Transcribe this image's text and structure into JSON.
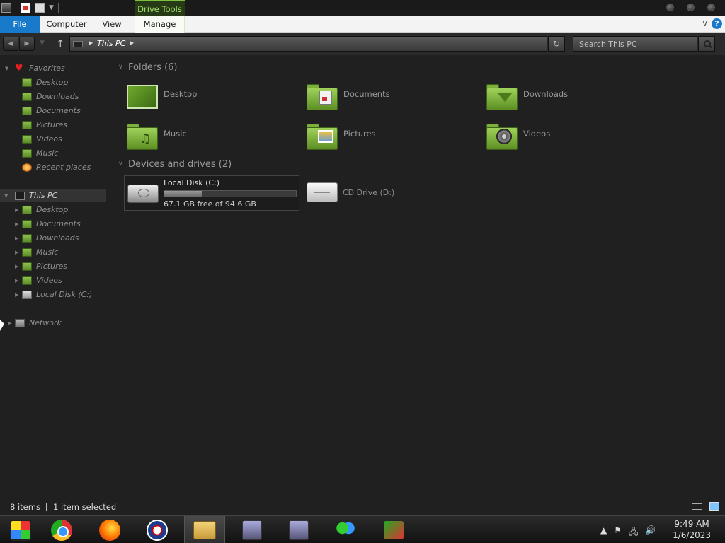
{
  "titlebar": {
    "context_tab": "Drive Tools"
  },
  "ribbon": {
    "tabs": [
      {
        "label": "File"
      },
      {
        "label": "Computer"
      },
      {
        "label": "View"
      },
      {
        "label": "Manage"
      }
    ],
    "help_label": "?",
    "accent": "#1979ca"
  },
  "address": {
    "path": "This PC",
    "search_placeholder": "Search This PC"
  },
  "navpane": {
    "favorites": {
      "label": "Favorites",
      "items": [
        {
          "label": "Desktop",
          "icon": "desktop-folder-icon"
        },
        {
          "label": "Downloads",
          "icon": "downloads-folder-icon"
        },
        {
          "label": "Documents",
          "icon": "documents-folder-icon"
        },
        {
          "label": "Pictures",
          "icon": "pictures-folder-icon"
        },
        {
          "label": "Videos",
          "icon": "videos-folder-icon"
        },
        {
          "label": "Music",
          "icon": "music-folder-icon"
        },
        {
          "label": "Recent places",
          "icon": "recent-places-icon"
        }
      ]
    },
    "this_pc": {
      "label": "This PC",
      "items": [
        {
          "label": "Desktop"
        },
        {
          "label": "Documents"
        },
        {
          "label": "Downloads"
        },
        {
          "label": "Music"
        },
        {
          "label": "Pictures"
        },
        {
          "label": "Videos"
        },
        {
          "label": "Local Disk (C:)"
        }
      ]
    },
    "network": {
      "label": "Network"
    }
  },
  "content": {
    "folders_header": "Folders (6)",
    "folders": [
      {
        "label": "Desktop"
      },
      {
        "label": "Documents"
      },
      {
        "label": "Downloads"
      },
      {
        "label": "Music"
      },
      {
        "label": "Pictures"
      },
      {
        "label": "Videos"
      }
    ],
    "devices_header": "Devices and drives (2)",
    "drives": [
      {
        "label": "Local Disk (C:)",
        "free_text": "67.1 GB free of 94.6 GB",
        "used_fraction": 0.29
      },
      {
        "label": "CD Drive (D:)"
      }
    ]
  },
  "status": {
    "items_count": "8 items",
    "selected": "1 item selected"
  },
  "taskbar": {
    "apps": [
      "start-orb",
      "chrome-icon",
      "firefox-icon",
      "obama-icon",
      "file-explorer-icon",
      "installer-icon",
      "installer-icon",
      "people-icon",
      "flag-app-icon"
    ],
    "time": "9:49 AM",
    "date": "1/6/2023"
  }
}
